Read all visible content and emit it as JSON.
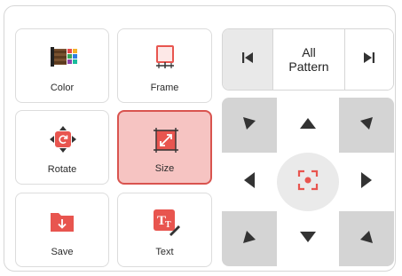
{
  "tools": {
    "color": {
      "label": "Color",
      "icon": "color-palette-icon"
    },
    "frame": {
      "label": "Frame",
      "icon": "frame-icon"
    },
    "rotate": {
      "label": "Rotate",
      "icon": "rotate-icon"
    },
    "size": {
      "label": "Size",
      "icon": "resize-icon",
      "active": true
    },
    "save": {
      "label": "Save",
      "icon": "save-folder-icon"
    },
    "text": {
      "label": "Text",
      "icon": "text-tool-icon"
    }
  },
  "pattern_nav": {
    "label_line1": "All",
    "label_line2": "Pattern",
    "prev_icon": "skip-previous-icon",
    "next_icon": "skip-next-icon"
  },
  "dpad": {
    "icons": [
      "arrow-up-left-icon",
      "arrow-up-icon",
      "arrow-up-right-icon",
      "arrow-left-icon",
      "center-focus-icon",
      "arrow-right-icon",
      "arrow-down-left-icon",
      "arrow-down-icon",
      "arrow-down-right-icon"
    ]
  },
  "colors": {
    "accent": "#e8554f",
    "active_bg": "#f6c4c2",
    "dark_icon": "#333333",
    "pad_gray": "#d4d4d4"
  }
}
